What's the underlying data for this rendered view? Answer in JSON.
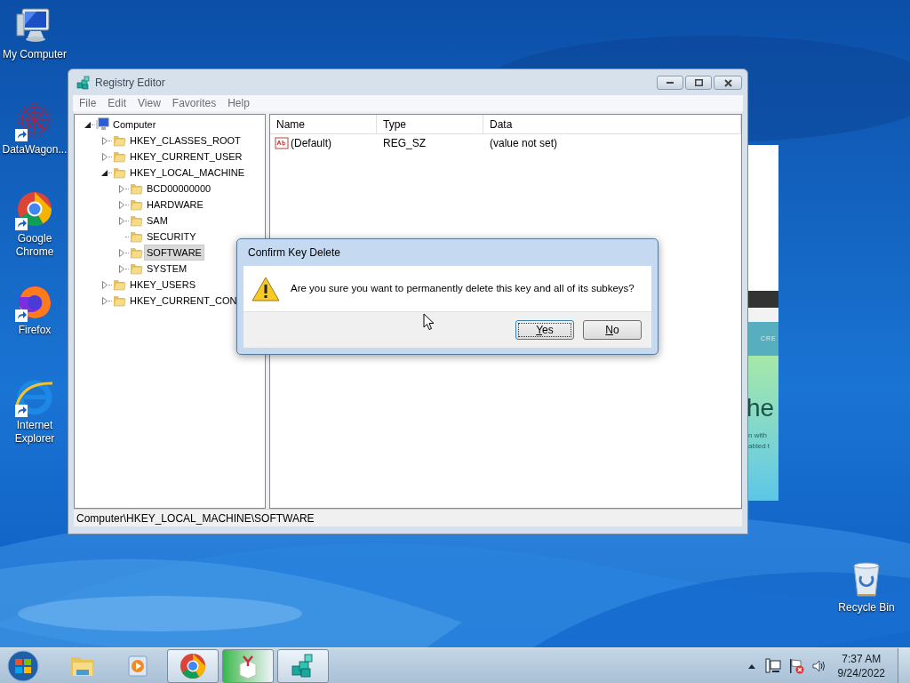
{
  "desktop_icons": [
    {
      "label": "My Computer",
      "kind": "computer",
      "shortcut": false
    },
    {
      "label": "DataWagon...",
      "kind": "network",
      "shortcut": true
    },
    {
      "label": "Google Chrome",
      "kind": "chrome",
      "shortcut": true
    },
    {
      "label": "Firefox",
      "kind": "firefox",
      "shortcut": true
    },
    {
      "label": "Internet Explorer",
      "kind": "ie",
      "shortcut": true
    },
    {
      "label": "Recycle Bin",
      "kind": "recycle",
      "shortcut": false
    }
  ],
  "background_window": {
    "banner": "CRE",
    "heading": "he",
    "lines": [
      "n with",
      "abled t"
    ]
  },
  "registry_editor": {
    "title": "Registry Editor",
    "menu": [
      "File",
      "Edit",
      "View",
      "Favorites",
      "Help"
    ],
    "tree": [
      {
        "label": "Computer",
        "kind": "computer",
        "has_children": true,
        "expanded": true,
        "selected": false,
        "children": [
          {
            "label": "HKEY_CLASSES_ROOT",
            "kind": "folder",
            "has_children": true,
            "expanded": false,
            "selected": false
          },
          {
            "label": "HKEY_CURRENT_USER",
            "kind": "folder",
            "has_children": true,
            "expanded": false,
            "selected": false
          },
          {
            "label": "HKEY_LOCAL_MACHINE",
            "kind": "folder",
            "has_children": true,
            "expanded": true,
            "selected": false,
            "children": [
              {
                "label": "BCD00000000",
                "kind": "folder",
                "has_children": true,
                "expanded": false,
                "selected": false
              },
              {
                "label": "HARDWARE",
                "kind": "folder",
                "has_children": true,
                "expanded": false,
                "selected": false
              },
              {
                "label": "SAM",
                "kind": "folder",
                "has_children": true,
                "expanded": false,
                "selected": false
              },
              {
                "label": "SECURITY",
                "kind": "folder",
                "has_children": false,
                "selected": false
              },
              {
                "label": "SOFTWARE",
                "kind": "folder",
                "has_children": true,
                "expanded": false,
                "selected": true
              },
              {
                "label": "SYSTEM",
                "kind": "folder",
                "has_children": true,
                "expanded": false,
                "selected": false
              }
            ]
          },
          {
            "label": "HKEY_USERS",
            "kind": "folder",
            "has_children": true,
            "expanded": false,
            "selected": false
          },
          {
            "label": "HKEY_CURRENT_CON",
            "kind": "folder",
            "has_children": true,
            "expanded": false,
            "selected": false
          }
        ]
      }
    ],
    "columns": [
      "Name",
      "Type",
      "Data"
    ],
    "rows": [
      {
        "name": "(Default)",
        "type": "REG_SZ",
        "data": "(value not set)"
      }
    ],
    "status_bar": "Computer\\HKEY_LOCAL_MACHINE\\SOFTWARE"
  },
  "dialog": {
    "title": "Confirm Key Delete",
    "message": "Are you sure you want to permanently delete this key and all of its subkeys?",
    "buttons": [
      {
        "label": "Yes",
        "default": true
      },
      {
        "label": "No",
        "default": false
      }
    ]
  },
  "taskbar": {
    "buttons": [
      {
        "kind": "explorer",
        "running": false,
        "active": false
      },
      {
        "kind": "media",
        "running": false,
        "active": false
      },
      {
        "kind": "chrome",
        "running": true,
        "active": false
      },
      {
        "kind": "app",
        "running": true,
        "active": true
      },
      {
        "kind": "regedit",
        "running": true,
        "active": false
      }
    ],
    "clock": {
      "time": "7:37 AM",
      "date": "9/24/2022"
    }
  }
}
